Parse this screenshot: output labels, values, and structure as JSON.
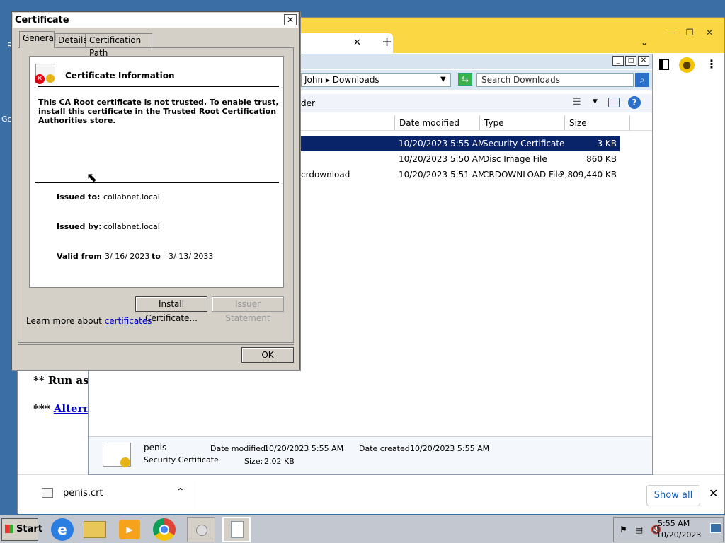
{
  "desktop": {
    "label_r": "R",
    "label_go": "Go"
  },
  "chrome": {
    "new_tab": "+",
    "tab_close": "✕",
    "page": {
      "line1": "** Run as a",
      "line2_prefix": "*** ",
      "line2_link": "Alterna"
    },
    "download": {
      "filename": "penis.crt",
      "show_all": "Show all"
    },
    "minimize": "—",
    "restore": "❐",
    "close": "✕"
  },
  "explorer": {
    "breadcrumb_user": "John",
    "breadcrumb_sep": "▸",
    "breadcrumb_folder": "Downloads",
    "search_placeholder": "Search Downloads",
    "toolbar_folder_text": "der",
    "columns": [
      "Date modified",
      "Type",
      "Size"
    ],
    "files": [
      {
        "name": "",
        "date": "10/20/2023 5:55 AM",
        "type": "Security Certificate",
        "size": "3 KB"
      },
      {
        "name": "",
        "date": "10/20/2023 5:50 AM",
        "type": "Disc Image File",
        "size": "860 KB"
      },
      {
        "name": "crdownload",
        "date": "10/20/2023 5:51 AM",
        "type": "CRDOWNLOAD File",
        "size": "2,809,440 KB"
      }
    ],
    "details": {
      "name": "penis",
      "type": "Security Certificate",
      "modified_label": "Date modified:",
      "modified_value": "10/20/2023 5:55 AM",
      "created_label": "Date created:",
      "created_value": "10/20/2023 5:55 AM",
      "size_label": "Size:",
      "size_value": "2.02 KB"
    }
  },
  "dialog": {
    "title": "Certificate",
    "close": "✕",
    "tabs": [
      "General",
      "Details",
      "Certification Path"
    ],
    "header": "Certificate Information",
    "warning": "This CA Root certificate is not trusted. To enable trust, install this certificate in the Trusted Root Certification Authorities store.",
    "issued_to_label": "Issued to:",
    "issued_to": "collabnet.local",
    "issued_by_label": "Issued by:",
    "issued_by": "collabnet.local",
    "valid_from_label": "Valid from",
    "valid_from": "3/ 16/ 2023",
    "valid_to_label": "to",
    "valid_to": "3/ 13/ 2033",
    "install_button": "Install Certificate...",
    "issuer_button": "Issuer Statement",
    "learn_prefix": "Learn more about ",
    "learn_link": "certificates",
    "ok_button": "OK"
  },
  "taskbar": {
    "start": "Start",
    "time": "5:55 AM",
    "date": "10/20/2023"
  },
  "colors": {
    "chrome_accent": "#fbd843",
    "selection": "#0a246a",
    "link": "#0000cc"
  }
}
